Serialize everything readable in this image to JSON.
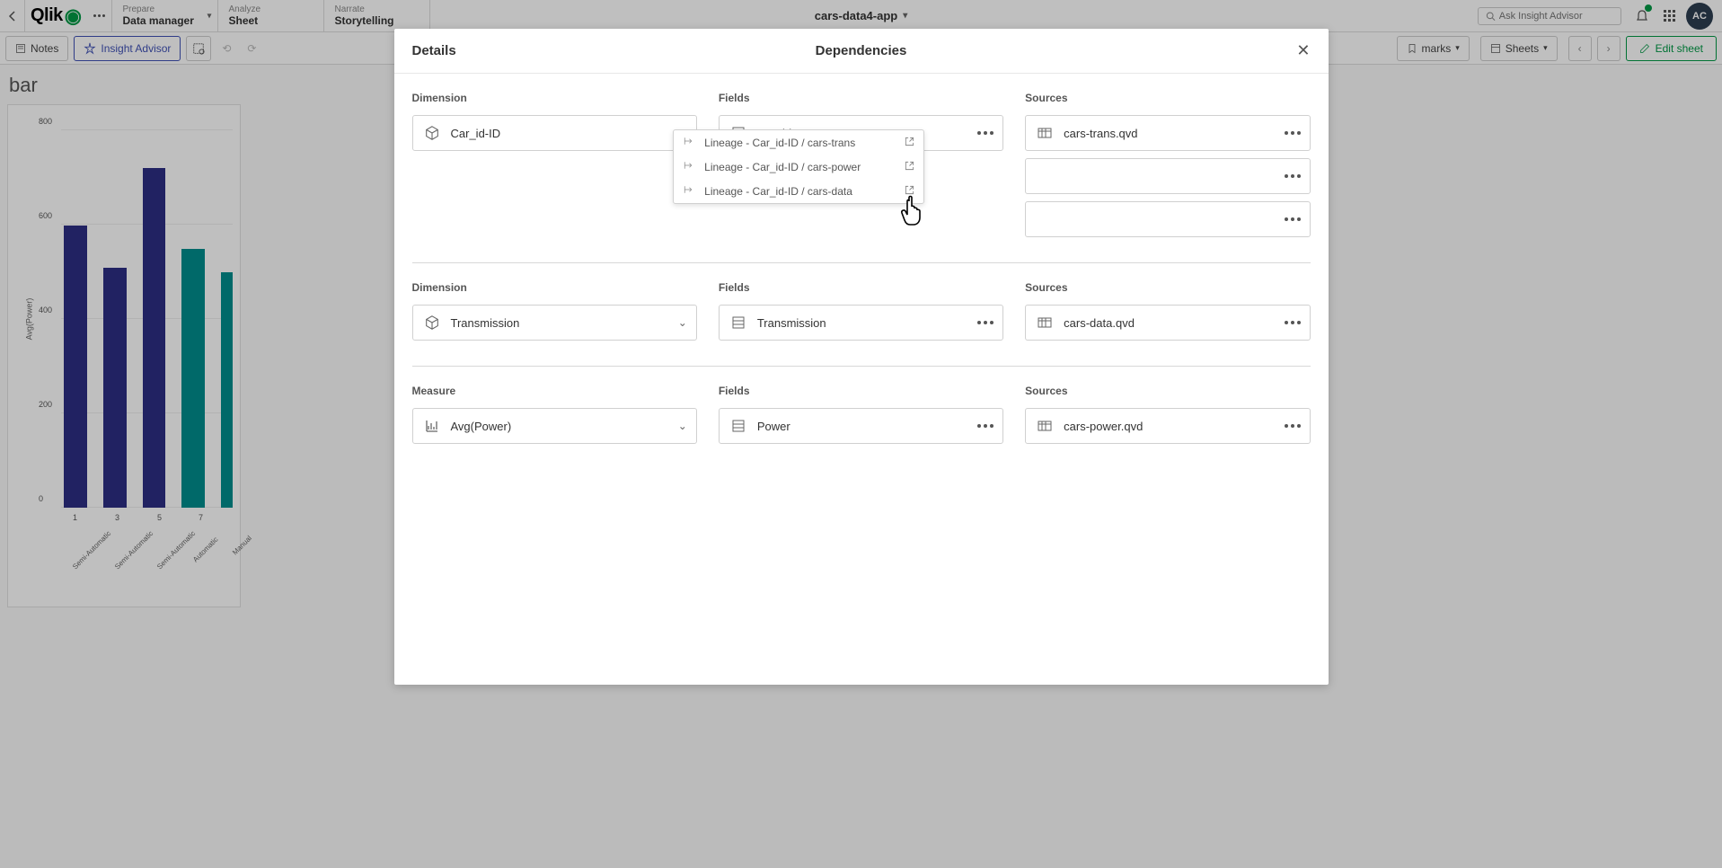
{
  "topbar": {
    "logo_text": "Qlik",
    "tabs": [
      {
        "label": "Prepare",
        "value": "Data manager",
        "dropdown": true
      },
      {
        "label": "Analyze",
        "value": "Sheet",
        "dropdown": false
      },
      {
        "label": "Narrate",
        "value": "Storytelling",
        "dropdown": false
      }
    ],
    "app_title": "cars-data4-app",
    "search_placeholder": "Ask Insight Advisor",
    "avatar_initials": "AC"
  },
  "toolbar": {
    "notes": "Notes",
    "insight": "Insight Advisor",
    "bookmarks": "marks",
    "sheets": "Sheets",
    "edit": "Edit sheet"
  },
  "chart": {
    "title": "bar",
    "y_label": "Avg(Power)",
    "y_ticks": [
      "0",
      "200",
      "400",
      "600",
      "800"
    ],
    "x_ticks": [
      "1",
      "3",
      "5",
      "7"
    ],
    "categories": [
      "Semi-Automatic",
      "Semi-Automatic",
      "Semi-Automatic",
      "Automatic",
      "Manual"
    ]
  },
  "chart_data": {
    "type": "bar",
    "categories": [
      "1 Semi-Automatic",
      "3 Semi-Automatic",
      "5 Semi-Automatic",
      "7 Automatic",
      "Manual"
    ],
    "values": [
      600,
      510,
      720,
      550,
      500
    ],
    "series_color": [
      "#2d2e83",
      "#2d2e83",
      "#2d2e83",
      "#008c8c",
      "#008c8c"
    ],
    "ylabel": "Avg(Power)",
    "title": "bar",
    "ylim": [
      0,
      800
    ]
  },
  "modal": {
    "title_left": "Details",
    "title_center": "Dependencies",
    "sections": [
      {
        "dim_label": "Dimension",
        "dim_value": "Car_id-ID",
        "fields_label": "Fields",
        "fields": [
          "Car_id-ID"
        ],
        "sources_label": "Sources",
        "sources": [
          "cars-trans.qvd"
        ],
        "lineage": [
          "Lineage - Car_id-ID / cars-trans",
          "Lineage - Car_id-ID / cars-power",
          "Lineage - Car_id-ID / cars-data"
        ],
        "extra_sources_dots": 2
      },
      {
        "dim_label": "Dimension",
        "dim_value": "Transmission",
        "fields_label": "Fields",
        "fields": [
          "Transmission"
        ],
        "sources_label": "Sources",
        "sources": [
          "cars-data.qvd"
        ]
      },
      {
        "dim_label": "Measure",
        "dim_value": "Avg(Power)",
        "fields_label": "Fields",
        "fields": [
          "Power"
        ],
        "sources_label": "Sources",
        "sources": [
          "cars-power.qvd"
        ]
      }
    ]
  }
}
